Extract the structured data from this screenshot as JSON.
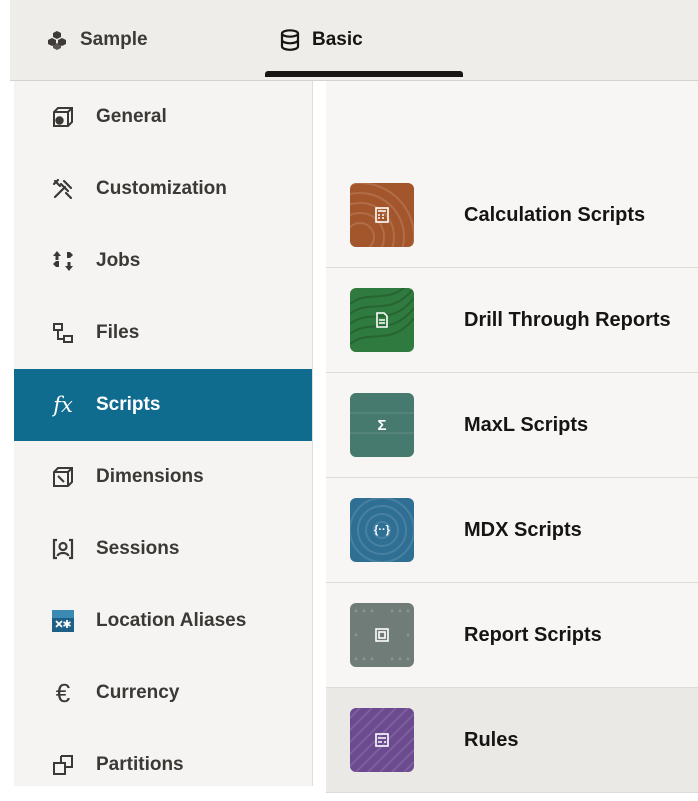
{
  "breadcrumb": [
    {
      "label": "Sample",
      "icon": "cubes-icon"
    },
    {
      "label": "Basic",
      "icon": "database-icon"
    }
  ],
  "sidebar": {
    "items": [
      {
        "label": "General",
        "icon": "cube-gear-icon"
      },
      {
        "label": "Customization",
        "icon": "tools-icon"
      },
      {
        "label": "Jobs",
        "icon": "jobs-arrows-icon"
      },
      {
        "label": "Files",
        "icon": "folder-tree-icon"
      },
      {
        "label": "Scripts",
        "icon": "fx-icon",
        "active": true
      },
      {
        "label": "Dimensions",
        "icon": "cube-icon"
      },
      {
        "label": "Sessions",
        "icon": "user-session-icon"
      },
      {
        "label": "Location Aliases",
        "icon": "location-alias-icon"
      },
      {
        "label": "Currency",
        "icon": "euro-icon"
      },
      {
        "label": "Partitions",
        "icon": "partitions-icon"
      }
    ]
  },
  "scripts": [
    {
      "label": "Calculation Scripts",
      "color": "#a3562b",
      "icon": "calculator-icon"
    },
    {
      "label": "Drill Through Reports",
      "color": "#2f7a3e",
      "icon": "document-icon"
    },
    {
      "label": "MaxL Scripts",
      "color": "#467a6e",
      "icon": "sigma-icon",
      "glyph": "Σ"
    },
    {
      "label": "MDX Scripts",
      "color": "#2f6f94",
      "icon": "braces-icon",
      "glyph": "{··}"
    },
    {
      "label": "Report Scripts",
      "color": "#6f7c78",
      "icon": "report-icon"
    },
    {
      "label": "Rules",
      "color": "#6b4a8f",
      "icon": "rules-icon",
      "selected": true
    }
  ],
  "colors": {
    "accent": "#0f6c8f"
  }
}
